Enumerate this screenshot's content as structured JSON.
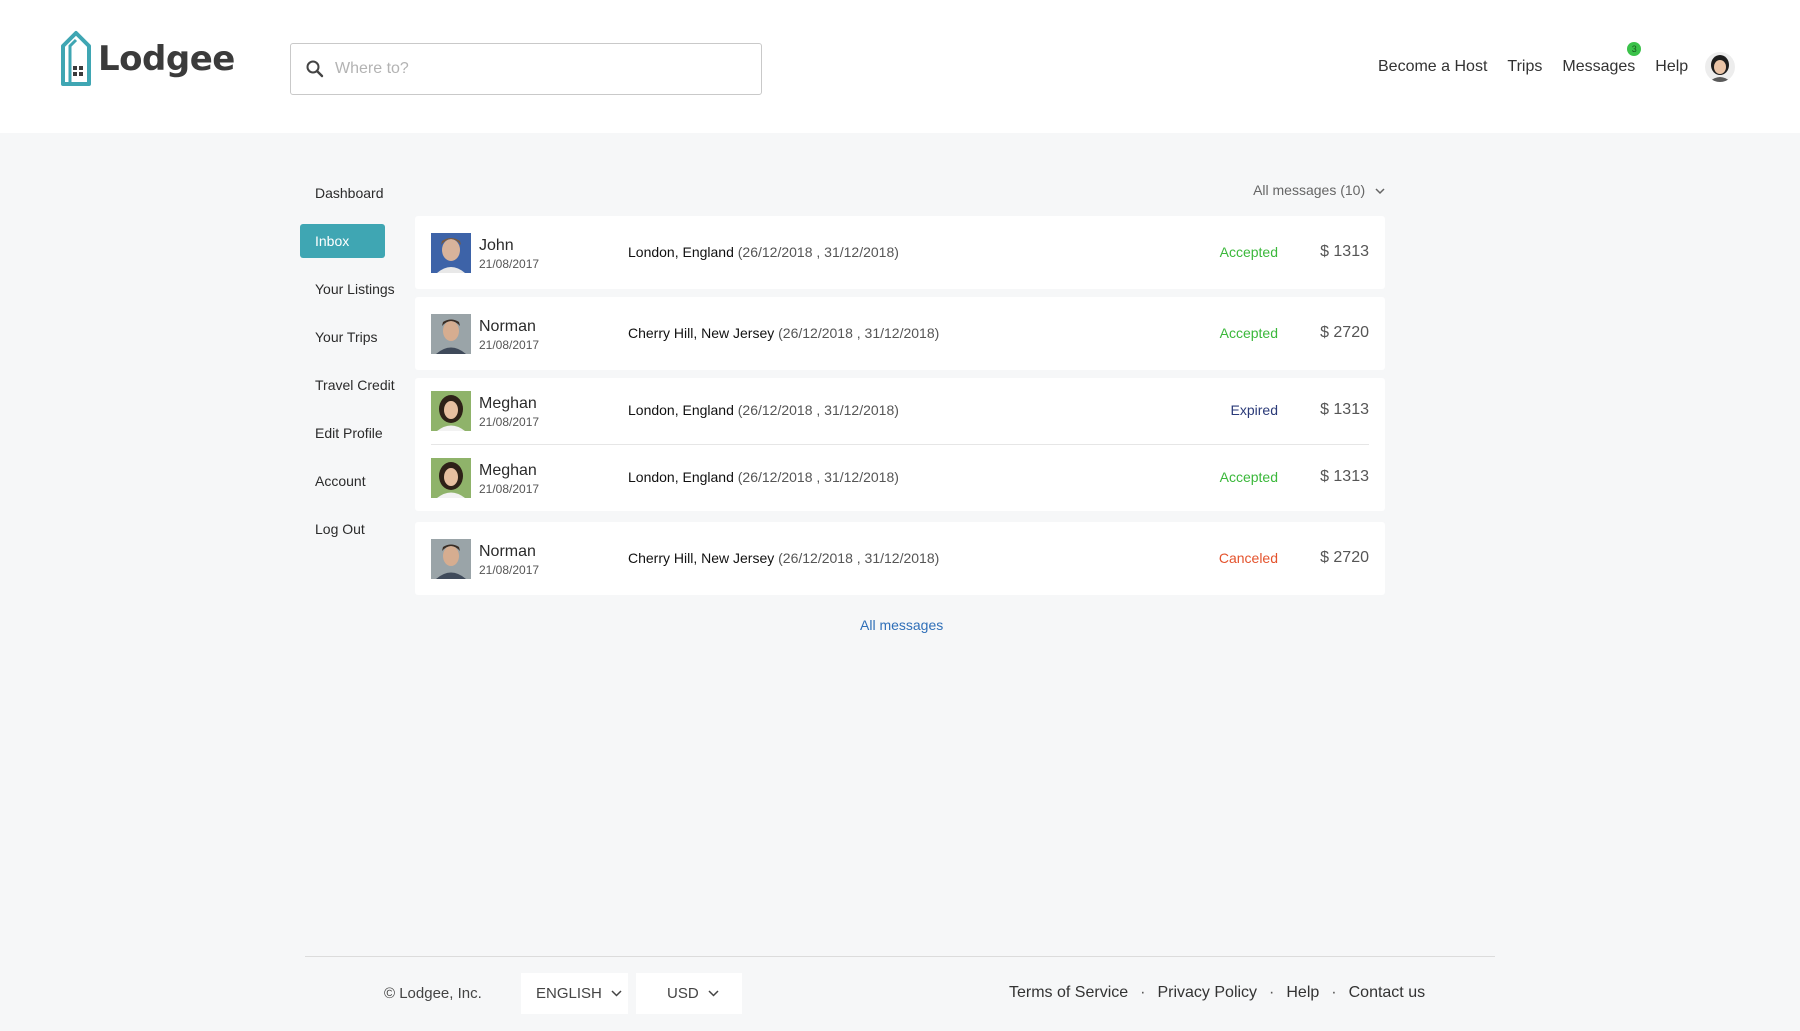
{
  "brand": {
    "name": "Lodgee",
    "accent": "#3fa6b3"
  },
  "search": {
    "placeholder": "Where to?",
    "icon": "search-icon"
  },
  "topnav": {
    "become_host": "Become a Host",
    "trips": "Trips",
    "messages": "Messages",
    "messages_badge": "3",
    "help": "Help"
  },
  "sidebar": {
    "items": [
      {
        "label": "Dashboard"
      },
      {
        "label": "Inbox",
        "active": true
      },
      {
        "label": "Your Listings"
      },
      {
        "label": "Your Trips"
      },
      {
        "label": "Travel Credit"
      },
      {
        "label": "Edit Profile"
      },
      {
        "label": "Account"
      },
      {
        "label": "Log Out"
      }
    ]
  },
  "filter": {
    "label": "All messages (10)"
  },
  "messages": [
    {
      "name": "John",
      "date": "21/08/2017",
      "location": "London, England",
      "dates": "(26/12/2018 , 31/12/2018)",
      "status": "Accepted",
      "price": "$ 1313"
    },
    {
      "name": "Norman",
      "date": "21/08/2017",
      "location": "Cherry Hill, New Jersey",
      "dates": "(26/12/2018 , 31/12/2018)",
      "status": "Accepted",
      "price": "$ 2720"
    },
    {
      "name": "Meghan",
      "date": "21/08/2017",
      "location": "London, England",
      "dates": "(26/12/2018 , 31/12/2018)",
      "status": "Expired",
      "price": "$ 1313"
    },
    {
      "name": "Meghan",
      "date": "21/08/2017",
      "location": "London, England",
      "dates": "(26/12/2018 , 31/12/2018)",
      "status": "Accepted",
      "price": "$ 1313"
    },
    {
      "name": "Norman",
      "date": "21/08/2017",
      "location": "Cherry Hill, New Jersey",
      "dates": "(26/12/2018 , 31/12/2018)",
      "status": "Canceled",
      "price": "$ 2720"
    }
  ],
  "status_colors": {
    "Accepted": "#3bb83b",
    "Expired": "#2a3a78",
    "Canceled": "#e4532d"
  },
  "all_messages_link": "All messages",
  "footer": {
    "copyright": "© Lodgee, Inc.",
    "language": "ENGLISH",
    "currency": "USD",
    "links": [
      "Terms of Service",
      "Privacy Policy",
      "Help",
      "Contact us"
    ],
    "separator": "·"
  }
}
